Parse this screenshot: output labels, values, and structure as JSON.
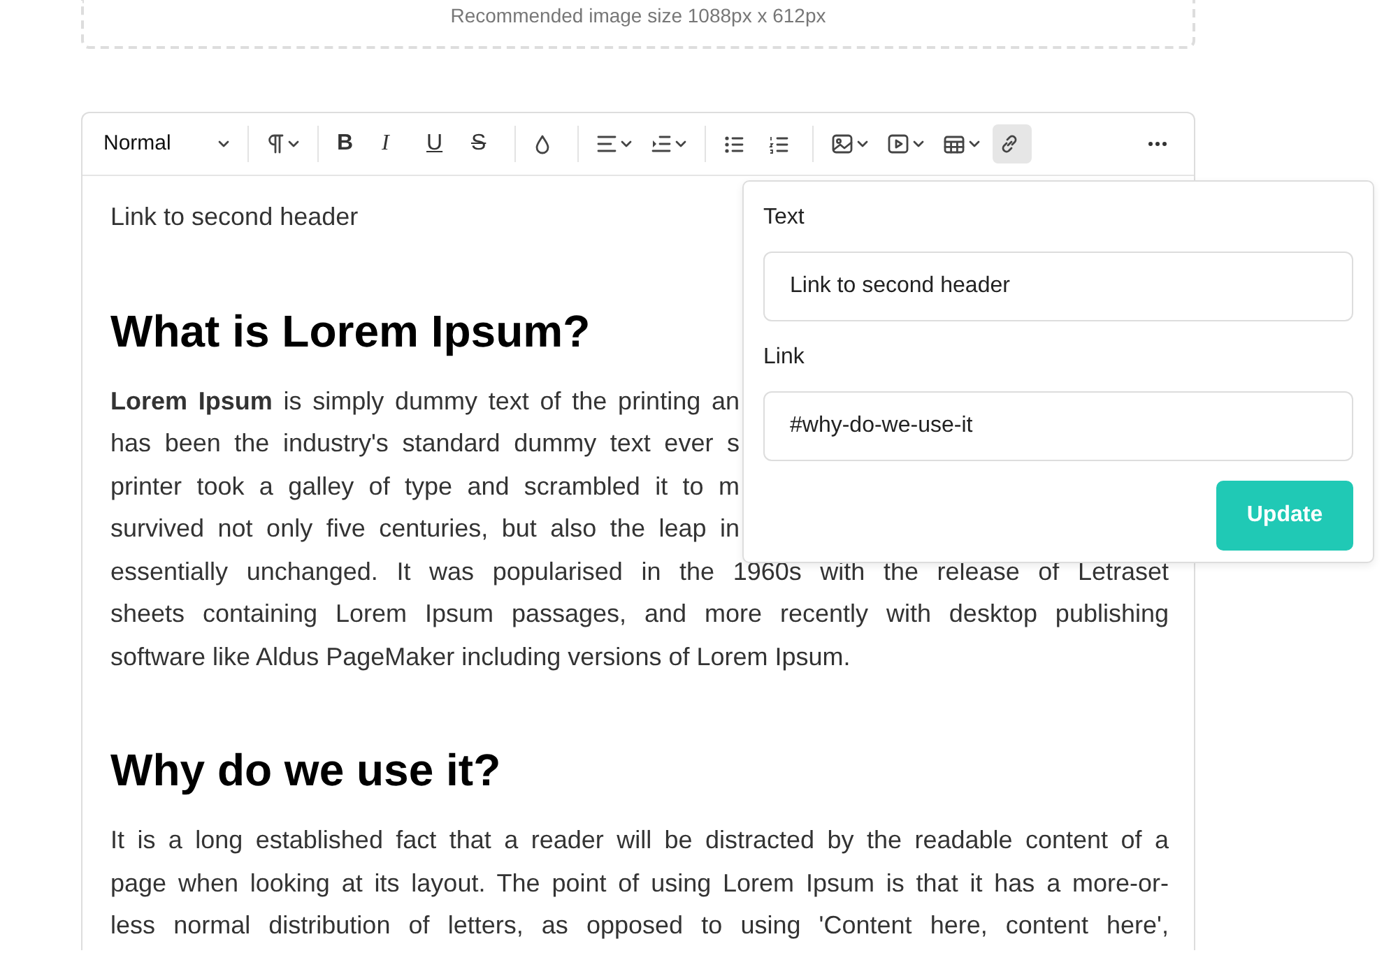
{
  "upload_hint": "Recommended image size 1088px x 612px",
  "toolbar": [
    {
      "kind": "dropdown",
      "label": "Normal"
    },
    {
      "kind": "separator"
    },
    {
      "kind": "paragraph",
      "has_menu": true,
      "active": false
    },
    {
      "kind": "separator"
    },
    {
      "kind": "bold",
      "label": "B",
      "active": false
    },
    {
      "kind": "italic",
      "label": "I",
      "active": false
    },
    {
      "kind": "underline",
      "label": "U",
      "active": false
    },
    {
      "kind": "strike",
      "label": "S",
      "active": false
    },
    {
      "kind": "separator"
    },
    {
      "kind": "color",
      "active": false
    },
    {
      "kind": "separator"
    },
    {
      "kind": "align",
      "has_menu": true,
      "active": false
    },
    {
      "kind": "indent",
      "has_menu": true,
      "active": false
    },
    {
      "kind": "separator"
    },
    {
      "kind": "bullets",
      "active": false
    },
    {
      "kind": "numbers",
      "active": false
    },
    {
      "kind": "separator"
    },
    {
      "kind": "image",
      "has_menu": true,
      "active": false
    },
    {
      "kind": "video",
      "has_menu": true,
      "active": false
    },
    {
      "kind": "table",
      "has_menu": true,
      "active": false
    },
    {
      "kind": "link",
      "active": true
    },
    {
      "kind": "spacer"
    },
    {
      "kind": "more",
      "active": false
    }
  ],
  "content": [
    {
      "kind": "paragraph",
      "lines": [
        "Link to second header"
      ]
    },
    {
      "kind": "heading",
      "text": "What is Lorem Ipsum?"
    },
    {
      "kind": "paragraph",
      "lines": [
        {
          "text": "**Lorem Ipsum** is simply dummy text of the printing an",
          "cut": true
        },
        {
          "text": "has been the industry's standard dummy text ever s",
          "cut": true
        },
        {
          "text": "printer took a galley of type and scrambled it to m",
          "cut": true
        },
        {
          "text": "survived not only five centuries, but also the leap in",
          "cut": true
        },
        {
          "text": "essentially unchanged. It was popularised in the 1960s with the release of Letraset",
          "cut": false
        },
        {
          "text": "sheets containing Lorem Ipsum passages, and more recently with desktop publishing",
          "cut": false
        },
        {
          "text": "software like Aldus PageMaker including versions of Lorem Ipsum.",
          "cut": false,
          "last": true
        }
      ]
    },
    {
      "kind": "heading",
      "text": "Why do we use it?"
    },
    {
      "kind": "paragraph",
      "lines": [
        {
          "text": "It is a long established fact that a reader will be distracted by the readable content of a",
          "cut": false
        },
        {
          "text": "page when looking at its layout. The point of using Lorem Ipsum is that it has a more-or-",
          "cut": false
        },
        {
          "text": "less normal distribution of letters, as opposed to using 'Content here, content here',",
          "cut": false
        }
      ]
    }
  ],
  "link_popover": {
    "text_label": "Text",
    "text_value": "Link to second header",
    "link_label": "Link",
    "link_value": "#why-do-we-use-it",
    "button": "Update"
  }
}
